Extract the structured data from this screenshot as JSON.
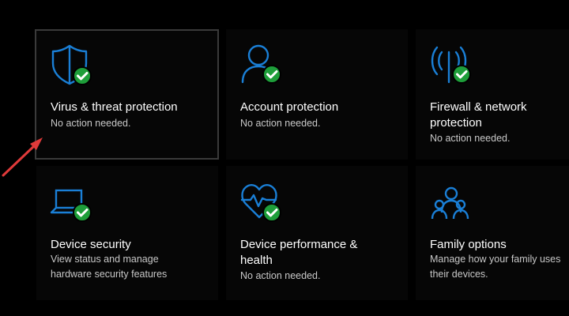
{
  "colors": {
    "accent": "#1a7fd6",
    "check_green": "#1e9e3a",
    "background": "#000000",
    "tile_background": "#060606",
    "arrow": "#e03a3a"
  },
  "tiles": [
    {
      "id": "virus",
      "icon": "shield-check-icon",
      "title_lines": [
        "Virus & threat protection"
      ],
      "status_lines": [
        "No action needed."
      ]
    },
    {
      "id": "account",
      "icon": "person-check-icon",
      "title_lines": [
        "Account protection"
      ],
      "status_lines": [
        "No action needed."
      ]
    },
    {
      "id": "firewall",
      "icon": "antenna-check-icon",
      "title_lines": [
        "Firewall & network",
        "protection"
      ],
      "status_lines": [
        "No action needed."
      ]
    },
    {
      "id": "device-security",
      "icon": "laptop-check-icon",
      "title_lines": [
        "Device security"
      ],
      "status_lines": [
        "View status and manage",
        "hardware security features"
      ]
    },
    {
      "id": "device-performance",
      "icon": "heart-pulse-check-icon",
      "title_lines": [
        "Device performance &",
        "health"
      ],
      "status_lines": [
        "No action needed."
      ]
    },
    {
      "id": "family",
      "icon": "family-icon",
      "title_lines": [
        "Family options"
      ],
      "status_lines": [
        "Manage how your family uses",
        "their devices."
      ]
    }
  ]
}
